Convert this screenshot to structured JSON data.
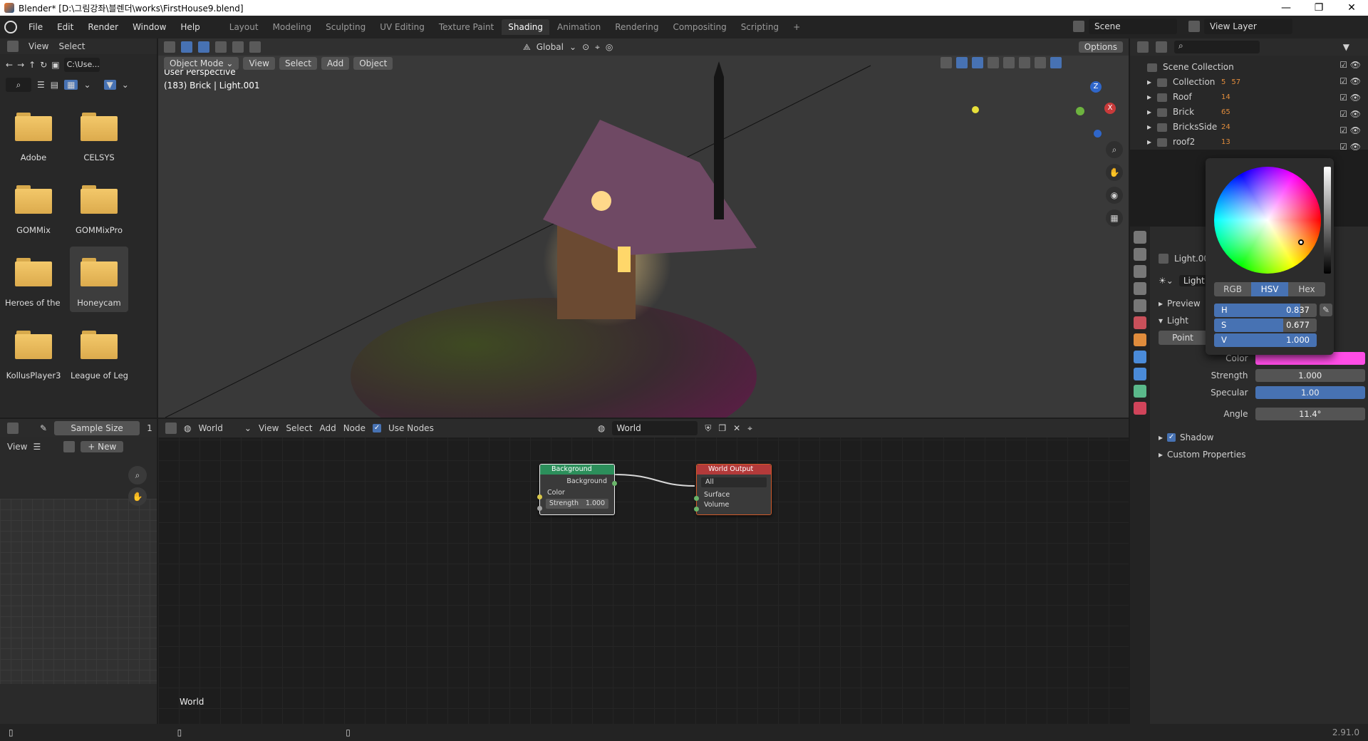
{
  "window": {
    "title": "Blender* [D:\\그림강좌\\블렌더\\works\\FirstHouse9.blend]",
    "controls": [
      "—",
      "❐",
      "✕"
    ]
  },
  "menu": [
    "File",
    "Edit",
    "Render",
    "Window",
    "Help"
  ],
  "workspaces": [
    "Layout",
    "Modeling",
    "Sculpting",
    "UV Editing",
    "Texture Paint",
    "Shading",
    "Animation",
    "Rendering",
    "Compositing",
    "Scripting"
  ],
  "workspace_active": "Shading",
  "workspace_add": "+",
  "scene": {
    "label": "Scene",
    "view_layer": "View Layer"
  },
  "filebrowser": {
    "menu": [
      "View",
      "Select"
    ],
    "path": "C:\\Use...",
    "items": [
      "Adobe",
      "CELSYS",
      "GOMMix",
      "GOMMixPro",
      "Heroes of the ...",
      "Honeycam",
      "KollusPlayer3",
      "League of Leg..."
    ],
    "selected": "Honeycam"
  },
  "viewport": {
    "mode": "Object Mode",
    "menu": [
      "View",
      "Select",
      "Add",
      "Object"
    ],
    "transform": "Global",
    "options": "Options",
    "info_title": "User Perspective",
    "info_sub": "(183) Brick | Light.001",
    "gizmo": {
      "z": "Z",
      "x": "X"
    }
  },
  "image_editor": {
    "sample_label": "Sample Size",
    "sample_value": "1",
    "view": "View",
    "new": "New"
  },
  "node_editor": {
    "world_type": "World",
    "menu": [
      "View",
      "Select",
      "Add",
      "Node"
    ],
    "use_nodes": "Use Nodes",
    "world_name": "World",
    "footer_label": "World",
    "bg_node": {
      "title": "Background",
      "output": "Background",
      "color": "Color",
      "strength_label": "Strength",
      "strength_value": "1.000"
    },
    "out_node": {
      "title": "World Output",
      "target": "All",
      "surface": "Surface",
      "volume": "Volume"
    }
  },
  "outliner": {
    "root": "Scene Collection",
    "items": [
      {
        "name": "Collection",
        "badge1": "5",
        "badge2": "57"
      },
      {
        "name": "Roof",
        "badge1": "14",
        "badge2": ""
      },
      {
        "name": "Brick",
        "badge1": "65",
        "badge2": ""
      },
      {
        "name": "BricksSide",
        "badge1": "24",
        "badge2": ""
      },
      {
        "name": "roof2",
        "badge1": "13",
        "badge2": ""
      }
    ]
  },
  "properties": {
    "object_name": "Light.00",
    "data_name": "Light.",
    "sections": {
      "preview": "Preview",
      "light": "Light",
      "shadow": "Shadow",
      "custom": "Custom Properties"
    },
    "light_type": "Point",
    "fields": [
      {
        "label": "Color",
        "value": ""
      },
      {
        "label": "Strength",
        "value": "1.000"
      },
      {
        "label": "Specular",
        "value": "1.00"
      },
      {
        "label": "Angle",
        "value": "11.4°"
      }
    ],
    "specular_fraction": 1.0
  },
  "color_picker": {
    "tabs": [
      "RGB",
      "HSV",
      "Hex"
    ],
    "active_tab": "HSV",
    "h_label": "H",
    "h_value": "0.837",
    "h_fraction": 0.837,
    "s_label": "S",
    "s_value": "0.677",
    "s_fraction": 0.677,
    "v_label": "V",
    "v_value": "1.000",
    "v_fraction": 1.0,
    "swatch": "#ff4de6"
  },
  "statusbar": {
    "version": "2.91.0"
  },
  "colors": {
    "accent": "#4772b3",
    "light_color": "#ff4de6",
    "node_bg_header": "#2c8f5b",
    "node_out_header": "#b33a3a"
  }
}
